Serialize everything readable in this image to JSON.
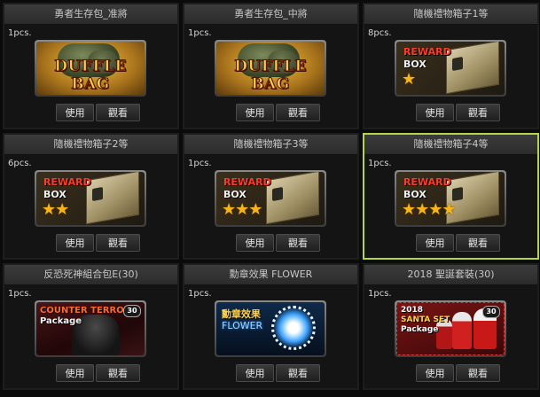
{
  "items": [
    {
      "title": "勇者生存包_准將",
      "qty": "1pcs.",
      "icon": "duffle-bag-icon",
      "art": {
        "word": "DUFFLE BAG"
      },
      "use": "使用",
      "view": "觀看"
    },
    {
      "title": "勇者生存包_中將",
      "qty": "1pcs.",
      "icon": "duffle-bag-icon",
      "art": {
        "word": "DUFFLE BAG"
      },
      "use": "使用",
      "view": "觀看"
    },
    {
      "title": "隨機禮物箱子1等",
      "qty": "8pcs.",
      "icon": "reward-box-icon",
      "art": {
        "l1": "REWARD",
        "l2": "BOX",
        "stars": "★"
      },
      "use": "使用",
      "view": "觀看"
    },
    {
      "title": "隨機禮物箱子2等",
      "qty": "6pcs.",
      "icon": "reward-box-icon",
      "art": {
        "l1": "REWARD",
        "l2": "BOX",
        "stars": "★★"
      },
      "use": "使用",
      "view": "觀看"
    },
    {
      "title": "隨機禮物箱子3等",
      "qty": "1pcs.",
      "icon": "reward-box-icon",
      "art": {
        "l1": "REWARD",
        "l2": "BOX",
        "stars": "★★★"
      },
      "use": "使用",
      "view": "觀看"
    },
    {
      "title": "隨機禮物箱子4等",
      "qty": "1pcs.",
      "icon": "reward-box-icon",
      "art": {
        "l1": "REWARD",
        "l2": "BOX",
        "stars": "★★★★"
      },
      "use": "使用",
      "view": "觀看"
    },
    {
      "title": "反恐死神組合包E(30)",
      "qty": "1pcs.",
      "icon": "counter-terror-package-icon",
      "art": {
        "l1": "COUNTER TERROR",
        "l2": "Package",
        "badge": "30"
      },
      "use": "使用",
      "view": "觀看"
    },
    {
      "title": "勳章效果 FLOWER",
      "qty": "1pcs.",
      "icon": "flower-medal-icon",
      "art": {
        "l1": "勳章效果",
        "l2": "FLOWER"
      },
      "use": "使用",
      "view": "觀看"
    },
    {
      "title": "2018 聖誕套裝(30)",
      "qty": "1pcs.",
      "icon": "santa-set-icon",
      "art": {
        "l1": "2018",
        "l2": "SANTA SET",
        "l3": "Package",
        "badge": "30"
      },
      "use": "使用",
      "view": "觀看"
    }
  ],
  "selected_index": 5,
  "colors": {
    "selected_border": "#b4d44a",
    "background": "#0b0b0b",
    "title_bar": "#333333"
  }
}
